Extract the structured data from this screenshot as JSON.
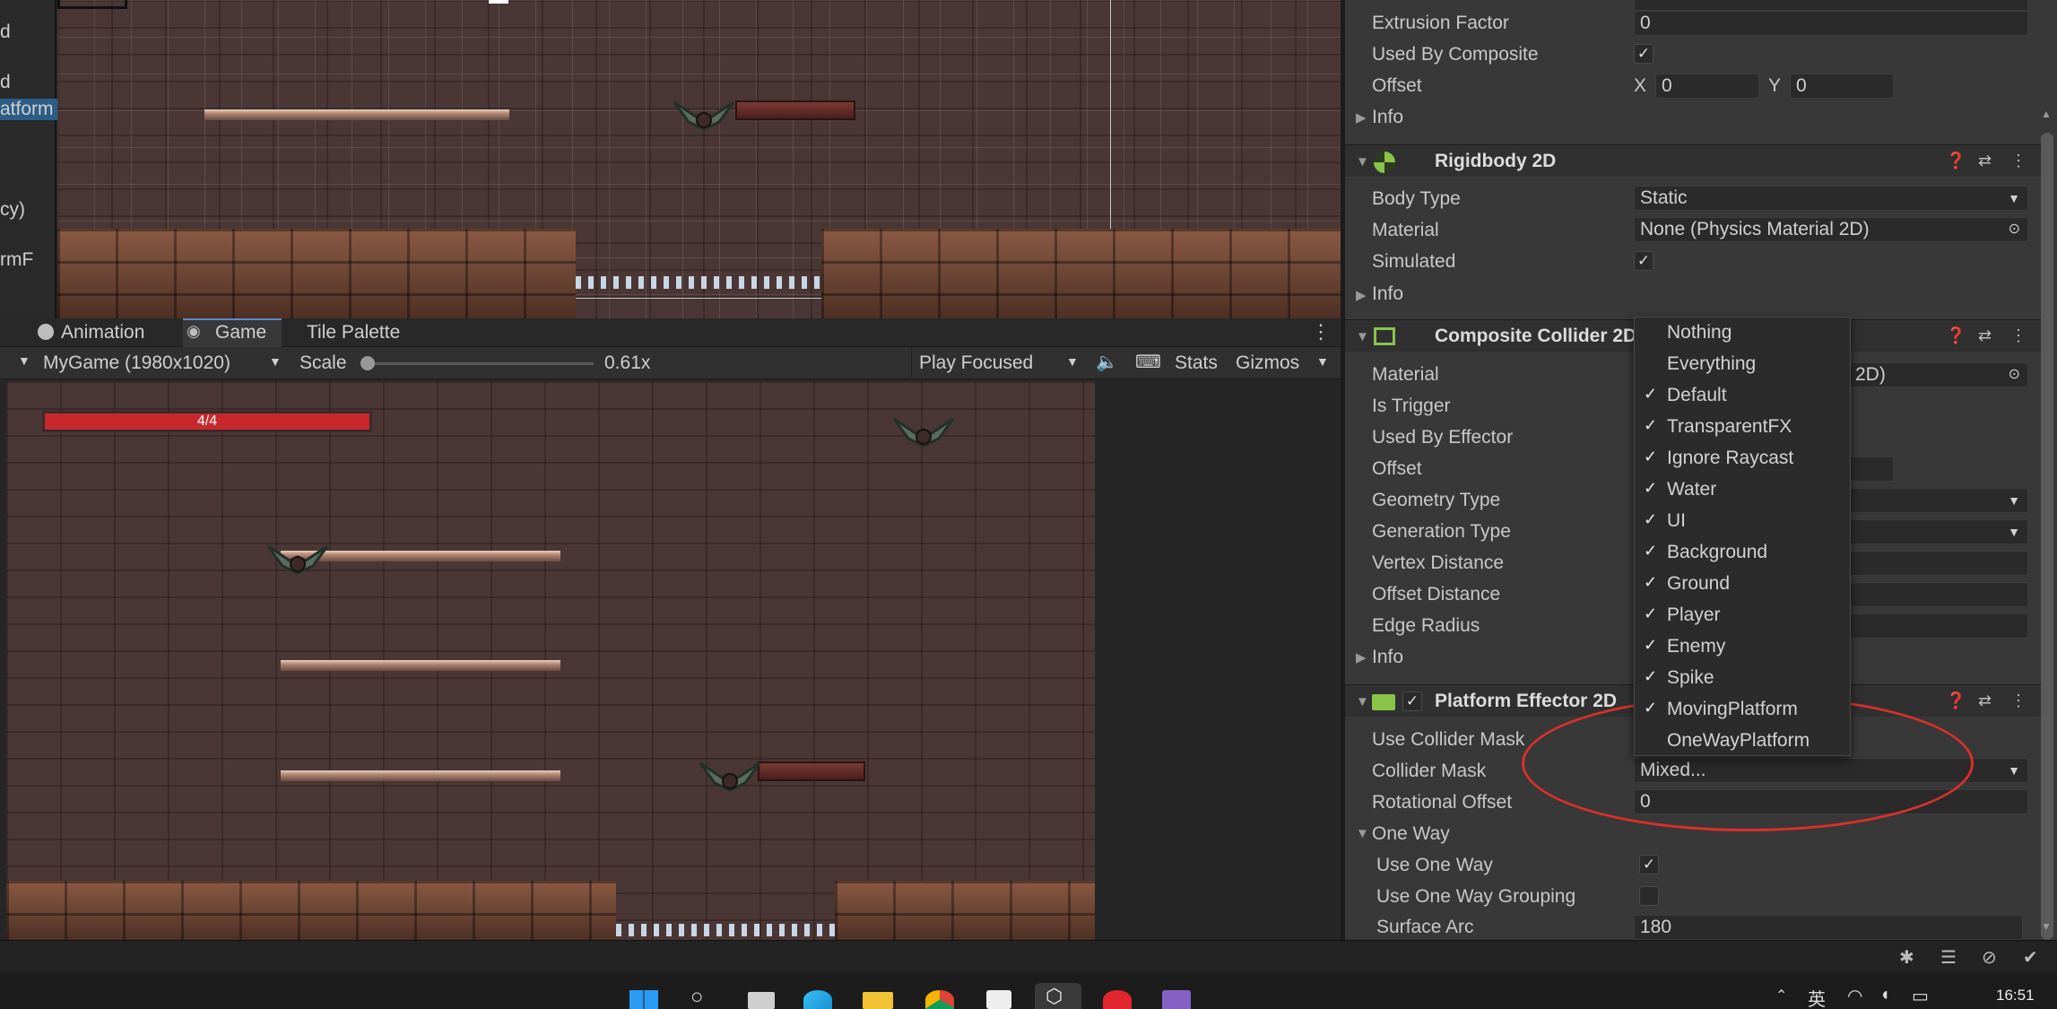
{
  "hierarchy_fragments": [
    "d",
    "d",
    "atform",
    "cy)",
    "rmF"
  ],
  "panel_tabs": {
    "animation": "Animation",
    "game": "Game",
    "tile_palette": "Tile Palette"
  },
  "game_toolbar": {
    "display": "MyGame (1980x1020)",
    "scale_label": "Scale",
    "scale_value": "0.61x",
    "play_mode": "Play Focused",
    "stats": "Stats",
    "gizmos": "Gizmos"
  },
  "game_view": {
    "health_text": "4/4",
    "health_value": 1.0
  },
  "inspector": {
    "top_fields": {
      "extrusion_label": "Extrusion Factor",
      "extrusion_value": "0",
      "used_by_composite_label": "Used By Composite",
      "offset_label": "Offset",
      "offset_x_label": "X",
      "offset_x": "0",
      "offset_y_label": "Y",
      "offset_y": "0",
      "info_label": "Info"
    },
    "rigidbody": {
      "title": "Rigidbody 2D",
      "body_type_label": "Body Type",
      "body_type_value": "Static",
      "material_label": "Material",
      "material_value": "None (Physics Material 2D)",
      "simulated_label": "Simulated",
      "info_label": "Info"
    },
    "composite": {
      "title": "Composite Collider 2D",
      "material_label": "Material",
      "material_value_tail": "2D)",
      "is_trigger_label": "Is Trigger",
      "used_by_effector_label": "Used By Effector",
      "offset_label": "Offset",
      "geometry_type_label": "Geometry Type",
      "generation_type_label": "Generation Type",
      "vertex_distance_label": "Vertex Distance",
      "offset_distance_label": "Offset Distance",
      "edge_radius_label": "Edge Radius",
      "info_label": "Info"
    },
    "platform_effector": {
      "title": "Platform Effector 2D",
      "use_collider_mask_label": "Use Collider Mask",
      "collider_mask_label": "Collider Mask",
      "collider_mask_value": "Mixed...",
      "rotational_offset_label": "Rotational Offset",
      "rotational_offset_value": "0",
      "one_way_label": "One Way",
      "use_one_way_label": "Use One Way",
      "use_one_way_grouping_label": "Use One Way Grouping",
      "surface_arc_label": "Surface Arc",
      "surface_arc_value": "180"
    }
  },
  "layer_menu": {
    "items": [
      {
        "label": "Nothing",
        "checked": false
      },
      {
        "label": "Everything",
        "checked": false
      },
      {
        "label": "Default",
        "checked": true
      },
      {
        "label": "TransparentFX",
        "checked": true
      },
      {
        "label": "Ignore Raycast",
        "checked": true
      },
      {
        "label": "Water",
        "checked": true
      },
      {
        "label": "UI",
        "checked": true
      },
      {
        "label": "Background",
        "checked": true
      },
      {
        "label": "Ground",
        "checked": true
      },
      {
        "label": "Player",
        "checked": true
      },
      {
        "label": "Enemy",
        "checked": true
      },
      {
        "label": "Spike",
        "checked": true
      },
      {
        "label": "MovingPlatform",
        "checked": true
      },
      {
        "label": "OneWayPlatform",
        "checked": false
      }
    ]
  },
  "taskbar": {
    "time": "16:51",
    "ime": "英"
  },
  "colors": {
    "annotation": "#d9302c",
    "health": "#c8282c",
    "accent": "#3a79d8"
  }
}
